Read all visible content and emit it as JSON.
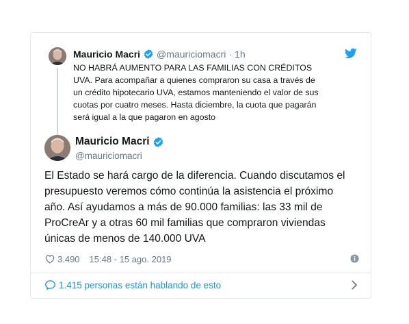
{
  "reply_tweet": {
    "author_name": "Mauricio Macri",
    "handle": "@mauriciomacri",
    "separator": "·",
    "time": "1h",
    "text": "NO HABRÁ AUMENTO PARA LAS FAMILIAS CON CRÉDITOS\nUVA. Para acompañar a quienes compraron su casa a través de\nun crédito hipotecario UVA, estamos manteniendo el valor de sus\ncuotas por cuatro meses. Hasta diciembre, la cuota que pagarán\nserá igual a la que pagaron en agosto"
  },
  "main_tweet": {
    "author_name": "Mauricio Macri",
    "handle": "@mauriciomacri",
    "text": "El Estado se hará cargo de la diferencia. Cuando discutamos el\npresupuesto veremos cómo continúa la asistencia el próximo\naño. Así ayudamos a más de 90.000 familias: las 33 mil de\nProCreAr y a otras 60 mil familias que compraron viviendas\núnicas de menos de 140.000 UVA",
    "like_count": "3.490",
    "timestamp": "15:48 - 15 ago. 2019"
  },
  "conversation": {
    "label": "1.415 personas están hablando de esto"
  },
  "icons": {
    "verified": "verified-badge-icon",
    "bird": "twitter-bird-icon",
    "heart": "heart-icon",
    "info": "info-icon",
    "bubble": "comment-bubble-icon",
    "chevron": "chevron-right-icon"
  },
  "colors": {
    "brand_blue": "#1da1f2",
    "link_blue": "#1b95e0",
    "muted_text": "#657786",
    "border": "#e1e8ed"
  }
}
